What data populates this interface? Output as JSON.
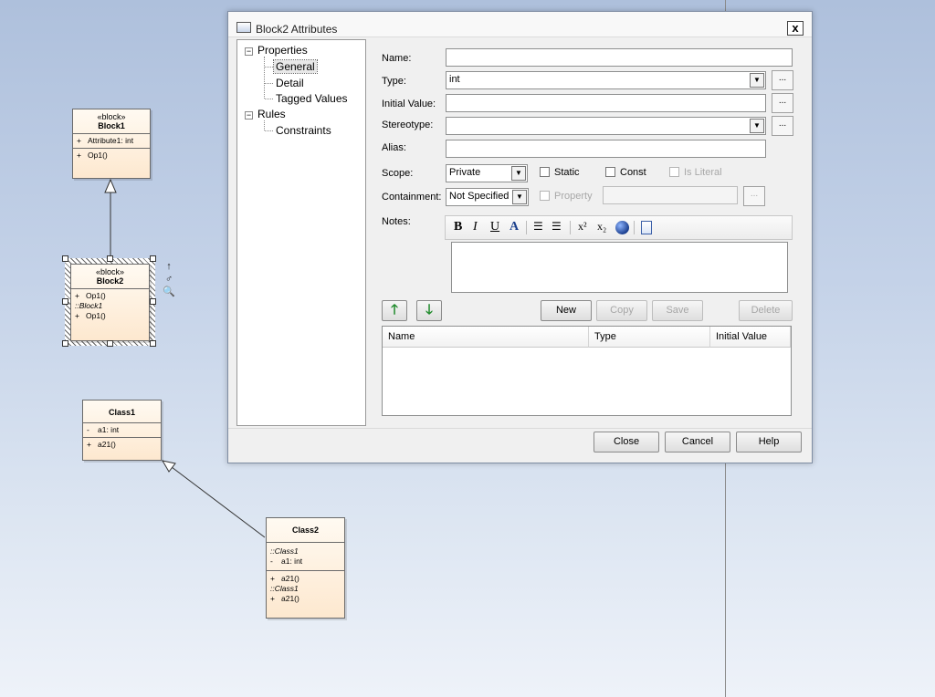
{
  "diagram": {
    "block1": {
      "stereotype": "«block»",
      "name": "Block1",
      "attributes": [
        {
          "vis": "+",
          "text": "Attribute1: int"
        }
      ],
      "operations": [
        {
          "vis": "+",
          "text": "Op1()"
        }
      ]
    },
    "block2": {
      "stereotype": "«block»",
      "name": "Block2",
      "op": {
        "vis": "+",
        "text": "Op1()"
      },
      "inherited_from": "::Block1",
      "inherited_op": {
        "vis": "+",
        "text": "Op1()"
      }
    },
    "class1": {
      "name": "Class1",
      "attr": {
        "vis": "-",
        "text": "a1: int"
      },
      "op": {
        "vis": "+",
        "text": "a21()"
      }
    },
    "class2": {
      "name": "Class2",
      "inherited_from_1": "::Class1",
      "attr": {
        "vis": "-",
        "text": "a1: int"
      },
      "op": {
        "vis": "+",
        "text": "a21()"
      },
      "inherited_from_2": "::Class1",
      "inherited_op": {
        "vis": "+",
        "text": "a21()"
      }
    },
    "tool_icons": [
      "↑",
      "♂",
      "🔍"
    ]
  },
  "dialog": {
    "title": "Block2 Attributes",
    "close_glyph": "x",
    "tree": {
      "properties": "Properties",
      "general": "General",
      "detail": "Detail",
      "tagged_values": "Tagged Values",
      "rules": "Rules",
      "constraints": "Constraints",
      "expander_glyph": "−"
    },
    "form": {
      "name_label": "Name:",
      "name_value": "",
      "type_label": "Type:",
      "type_value": "int",
      "initial_label": "Initial Value:",
      "initial_value": "",
      "stereotype_label": "Stereotype:",
      "stereotype_value": "",
      "alias_label": "Alias:",
      "alias_value": "",
      "scope_label": "Scope:",
      "scope_value": "Private",
      "static_label": "Static",
      "const_label": "Const",
      "isliteral_label": "Is Literal",
      "containment_label": "Containment:",
      "containment_value": "Not Specified",
      "property_label": "Property",
      "notes_label": "Notes:",
      "ellipsis": "...",
      "dropdown_glyph": "▼"
    },
    "notes_toolbar": {
      "bold": "B",
      "italic": "I",
      "underline": "U",
      "font_color": "A",
      "bullets": "☰",
      "numbering": "☰",
      "superscript": "x²",
      "subscript": "x₂"
    },
    "buttons": {
      "up": "🡑",
      "down": "🡓",
      "new": "New",
      "copy": "Copy",
      "save": "Save",
      "delete": "Delete",
      "close": "Close",
      "cancel": "Cancel",
      "help": "Help"
    },
    "list": {
      "columns": [
        "Name",
        "Type",
        "Initial Value"
      ]
    }
  }
}
